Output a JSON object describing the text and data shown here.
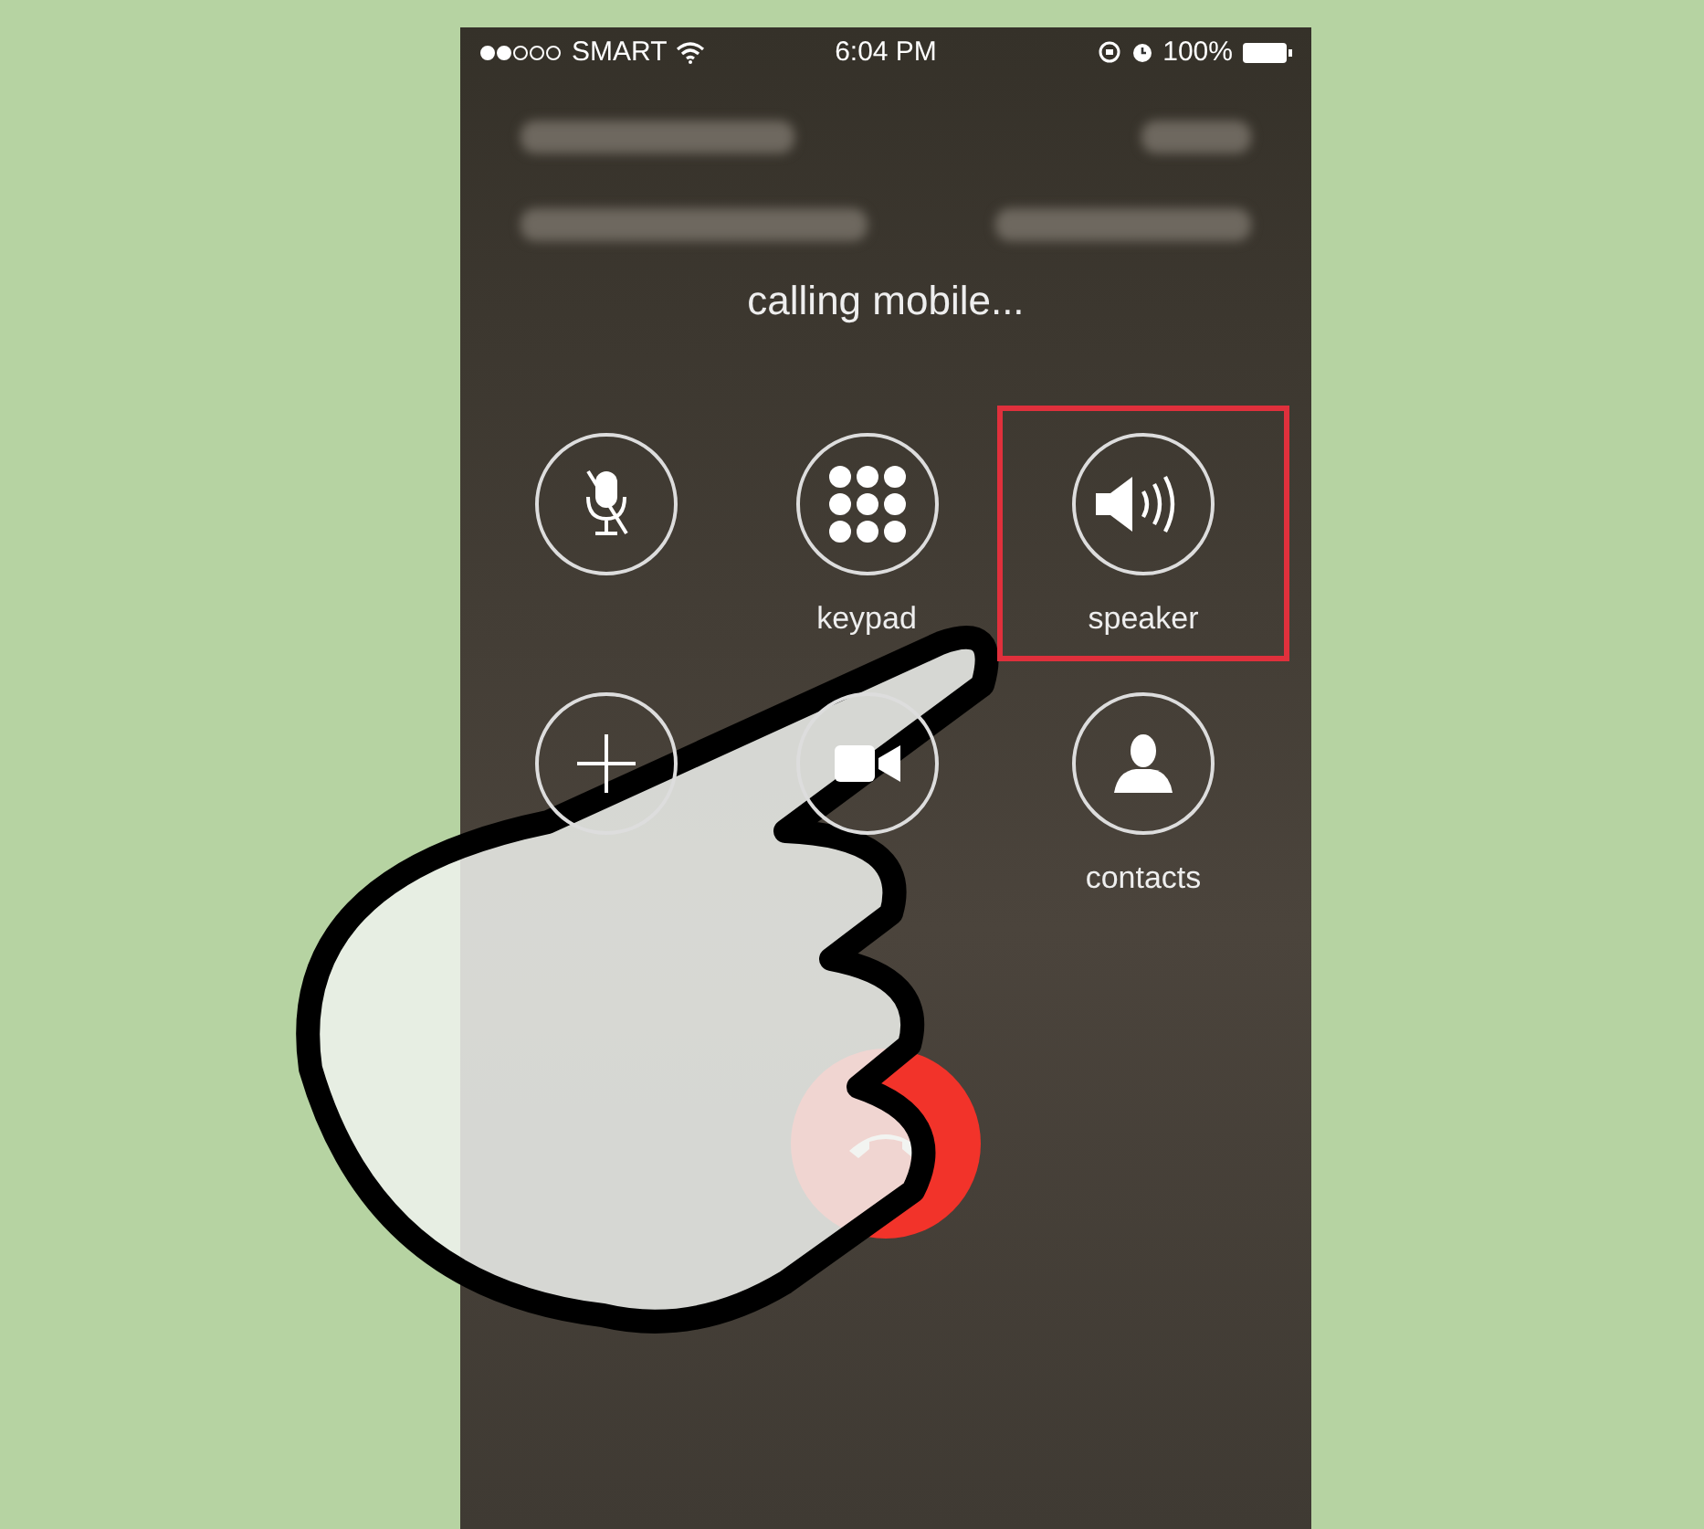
{
  "status_bar": {
    "carrier": "SMART",
    "time": "6:04 PM",
    "battery": "100%"
  },
  "call": {
    "status": "calling mobile..."
  },
  "buttons": [
    {
      "kind": "mute",
      "highlighted": false
    },
    {
      "kind": "keypad",
      "label": "keypad",
      "highlighted": false
    },
    {
      "kind": "speaker",
      "label": "speaker",
      "highlighted": true
    },
    {
      "kind": "add",
      "highlighted": false
    },
    {
      "kind": "facetime",
      "highlighted": false
    },
    {
      "kind": "contacts",
      "label": "contacts",
      "highlighted": false
    }
  ]
}
